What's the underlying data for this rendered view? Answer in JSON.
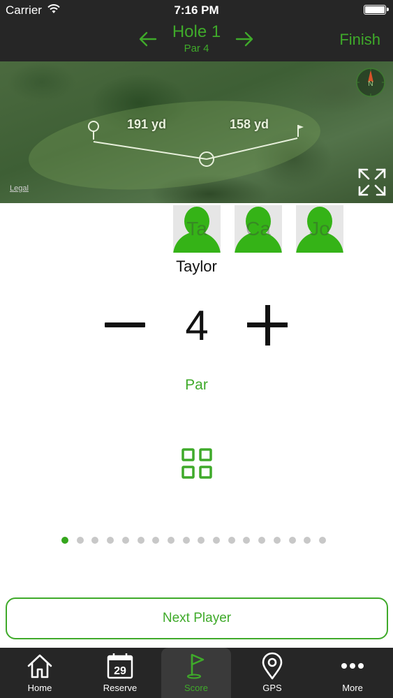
{
  "status_bar": {
    "carrier": "Carrier",
    "time": "7:16 PM"
  },
  "header": {
    "title": "Hole 1",
    "subtitle": "Par 4",
    "finish_label": "Finish"
  },
  "map": {
    "distance_1": "191 yd",
    "distance_2": "158 yd",
    "legal_label": "Legal",
    "compass_label": "N"
  },
  "players": [
    {
      "initials": "Ta"
    },
    {
      "initials": "Ca"
    },
    {
      "initials": "Jo"
    }
  ],
  "current_player": {
    "name": "Taylor",
    "score": "4",
    "score_label": "Par"
  },
  "pager": {
    "total": 18,
    "active": 0
  },
  "next_button_label": "Next Player",
  "tabs": [
    {
      "label": "Home",
      "icon": "home-icon"
    },
    {
      "label": "Reserve",
      "icon": "calendar-icon",
      "icon_text": "29"
    },
    {
      "label": "Score",
      "icon": "flag-icon",
      "active": true
    },
    {
      "label": "GPS",
      "icon": "location-pin-icon"
    },
    {
      "label": "More",
      "icon": "more-dots-icon"
    }
  ],
  "colors": {
    "accent": "#3faa2a",
    "bar_background": "#262626",
    "avatar_green": "#35b317"
  }
}
